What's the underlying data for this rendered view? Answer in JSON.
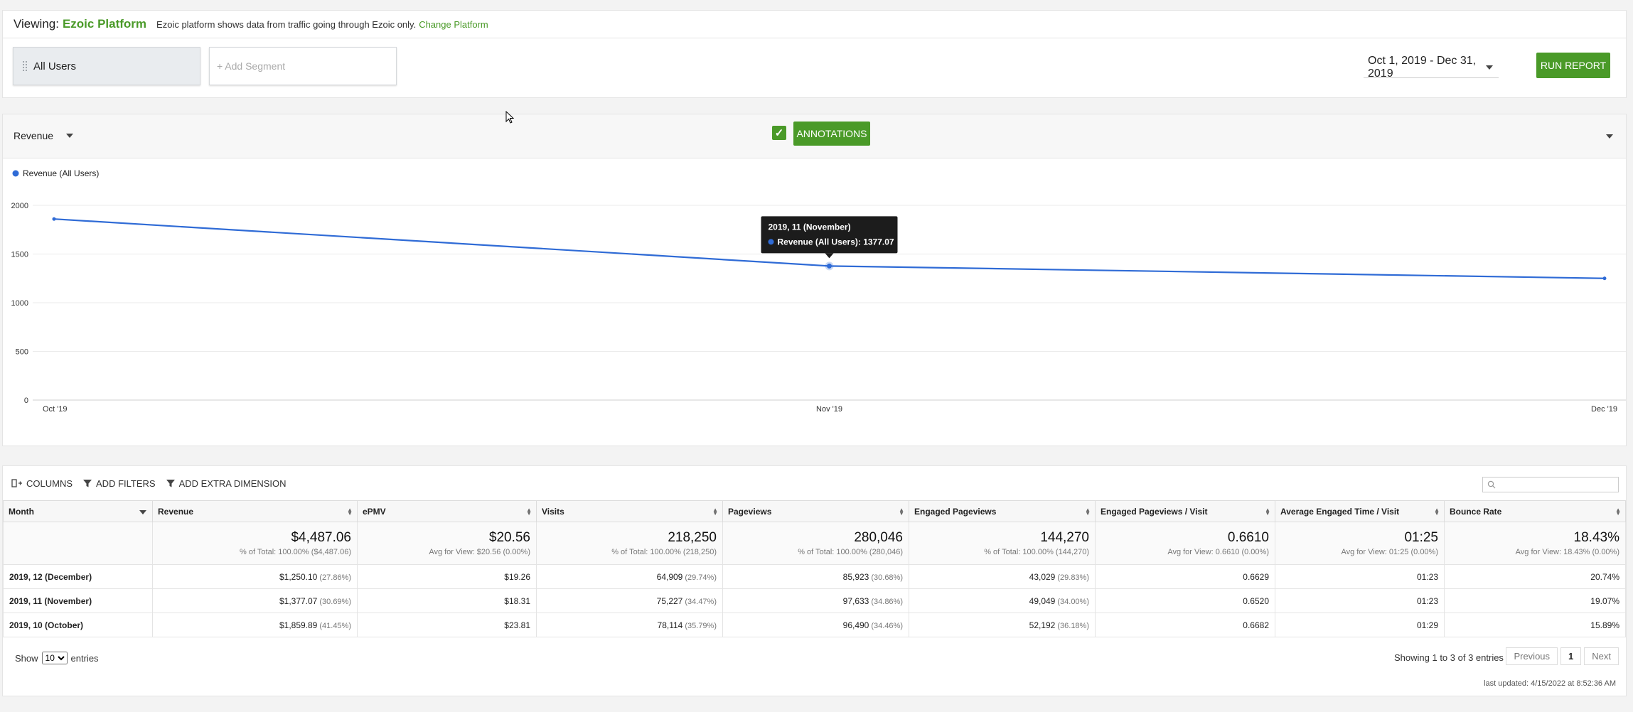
{
  "platform": {
    "viewing_label": "Viewing:",
    "platform_name": "Ezoic Platform",
    "note": "Ezoic platform shows data from traffic going through Ezoic only.",
    "change_link": "Change Platform"
  },
  "segments": {
    "active": "All Users",
    "add_placeholder": "+ Add Segment"
  },
  "date_range": "Oct 1, 2019 - Dec 31, 2019",
  "run_report": "RUN REPORT",
  "chart_controls": {
    "metric": "Revenue",
    "annotations_label": "ANNOTATIONS",
    "annotations_checked": true
  },
  "tooltip": {
    "title": "2019, 11 (November)",
    "line": "Revenue (All Users): 1377.07"
  },
  "chart_data": {
    "type": "line",
    "x": [
      "Oct '19",
      "Nov '19",
      "Dec '19"
    ],
    "series": [
      {
        "name": "Revenue (All Users)",
        "values": [
          1859.89,
          1377.07,
          1250.1
        ],
        "color": "#2f6bd6"
      }
    ],
    "yticks": [
      0,
      500,
      1000,
      1500,
      2000
    ],
    "ylim": [
      0,
      2000
    ],
    "legend": "top-left",
    "grid": true
  },
  "toolbar": {
    "columns": "COLUMNS",
    "add_filters": "ADD FILTERS",
    "add_dimension": "ADD EXTRA DIMENSION"
  },
  "table": {
    "headers": [
      "Month",
      "Revenue",
      "ePMV",
      "Visits",
      "Pageviews",
      "Engaged Pageviews",
      "Engaged Pageviews / Visit",
      "Average Engaged Time / Visit",
      "Bounce Rate"
    ],
    "totals": [
      {
        "main": "",
        "sub": ""
      },
      {
        "main": "$4,487.06",
        "sub": "% of Total: 100.00% ($4,487.06)"
      },
      {
        "main": "$20.56",
        "sub": "Avg for View: $20.56 (0.00%)"
      },
      {
        "main": "218,250",
        "sub": "% of Total: 100.00% (218,250)"
      },
      {
        "main": "280,046",
        "sub": "% of Total: 100.00% (280,046)"
      },
      {
        "main": "144,270",
        "sub": "% of Total: 100.00% (144,270)"
      },
      {
        "main": "0.6610",
        "sub": "Avg for View: 0.6610 (0.00%)"
      },
      {
        "main": "01:25",
        "sub": "Avg for View: 01:25 (0.00%)"
      },
      {
        "main": "18.43%",
        "sub": "Avg for View: 18.43% (0.00%)"
      }
    ],
    "rows": [
      {
        "month": "2019, 12 (December)",
        "revenue": "$1,250.10",
        "revenue_pct": "(27.86%)",
        "epmv": "$19.26",
        "visits": "64,909",
        "visits_pct": "(29.74%)",
        "pageviews": "85,923",
        "pageviews_pct": "(30.68%)",
        "engaged": "43,029",
        "engaged_pct": "(29.83%)",
        "epv": "0.6629",
        "aet": "01:23",
        "bounce": "20.74%"
      },
      {
        "month": "2019, 11 (November)",
        "revenue": "$1,377.07",
        "revenue_pct": "(30.69%)",
        "epmv": "$18.31",
        "visits": "75,227",
        "visits_pct": "(34.47%)",
        "pageviews": "97,633",
        "pageviews_pct": "(34.86%)",
        "engaged": "49,049",
        "engaged_pct": "(34.00%)",
        "epv": "0.6520",
        "aet": "01:23",
        "bounce": "19.07%"
      },
      {
        "month": "2019, 10 (October)",
        "revenue": "$1,859.89",
        "revenue_pct": "(41.45%)",
        "epmv": "$23.81",
        "visits": "78,114",
        "visits_pct": "(35.79%)",
        "pageviews": "96,490",
        "pageviews_pct": "(34.46%)",
        "engaged": "52,192",
        "engaged_pct": "(36.18%)",
        "epv": "0.6682",
        "aet": "01:29",
        "bounce": "15.89%"
      }
    ]
  },
  "footer": {
    "show_label": "Show",
    "show_value": "10",
    "entries_label": "entries",
    "info": "Showing 1 to 3 of 3 entries",
    "prev": "Previous",
    "page": "1",
    "next": "Next",
    "last_updated": "last updated: 4/15/2022 at 8:52:36 AM"
  },
  "colors": {
    "accent": "#4a9a28",
    "series": "#2f6bd6"
  }
}
